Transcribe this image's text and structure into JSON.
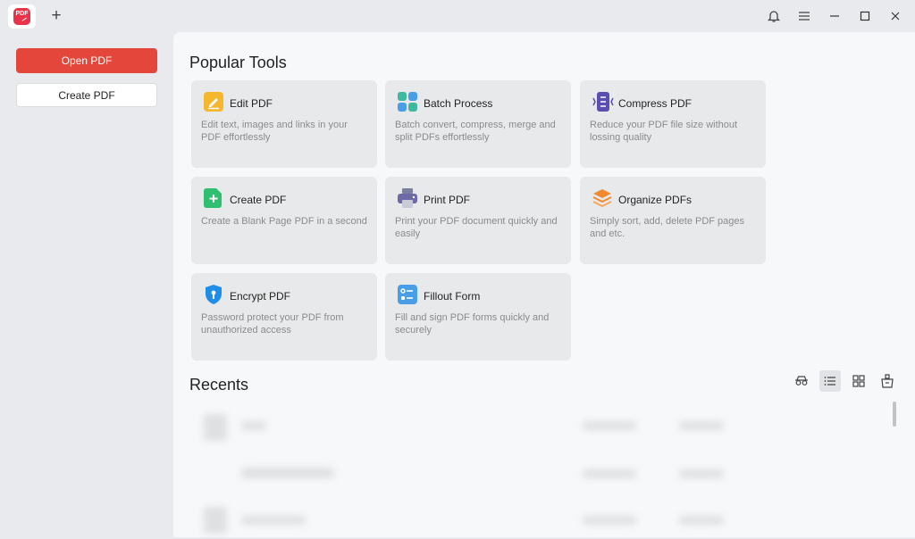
{
  "titlebar": {
    "logo_text": "PDF",
    "new_tab": "+",
    "icons": [
      "bell-icon",
      "menu-icon",
      "minimize-icon",
      "maximize-icon",
      "close-icon"
    ]
  },
  "sidebar": {
    "open_label": "Open PDF",
    "create_label": "Create PDF",
    "accent": "#e5463b"
  },
  "main": {
    "popular_title": "Popular Tools",
    "recents_title": "Recents",
    "tools": [
      {
        "name": "Edit PDF",
        "desc": "Edit text, images and links in your PDF effortlessly",
        "icon": "edit-icon"
      },
      {
        "name": "Batch Process",
        "desc": "Batch convert, compress, merge and split PDFs effortlessly",
        "icon": "batch-icon"
      },
      {
        "name": "Compress PDF",
        "desc": "Reduce your PDF file size without lossing quality",
        "icon": "compress-icon"
      },
      {
        "name": "Create PDF",
        "desc": "Create a Blank Page PDF in a second",
        "icon": "create-icon"
      },
      {
        "name": "Print PDF",
        "desc": "Print your PDF document quickly and easily",
        "icon": "print-icon"
      },
      {
        "name": "Organize PDFs",
        "desc": "Simply sort, add, delete PDF pages and etc.",
        "icon": "organize-icon"
      },
      {
        "name": "Encrypt PDF",
        "desc": "Password protect your PDF from unauthorized access",
        "icon": "shield-icon"
      },
      {
        "name": "Fillout Form",
        "desc": "Fill and sign PDF forms quickly and securely",
        "icon": "form-icon"
      }
    ],
    "view_controls": [
      "privacy-icon",
      "list-view-icon",
      "grid-view-icon",
      "clean-icon"
    ]
  }
}
